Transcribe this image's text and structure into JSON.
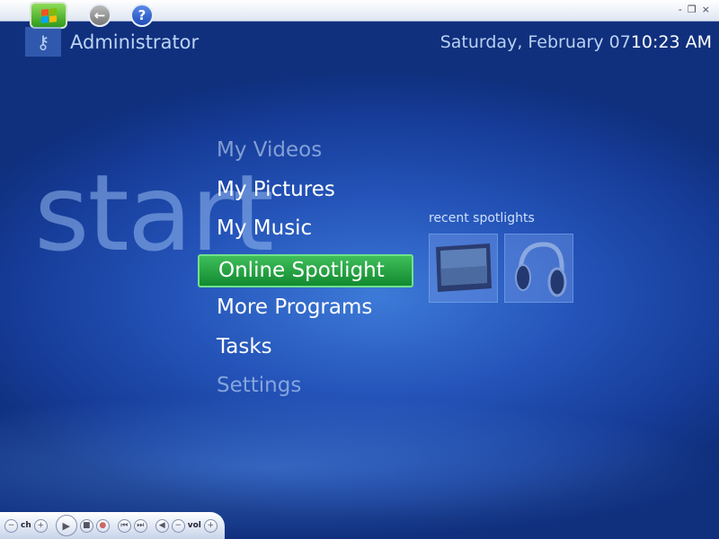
{
  "header": {
    "user": "Administrator",
    "date": "Saturday, February 07",
    "time": "10:23 AM"
  },
  "window_controls": {
    "minimize": "-",
    "restore": "❐",
    "close": "×"
  },
  "background_word": "start",
  "menu": {
    "items": [
      {
        "label": "My Videos",
        "state": "faded"
      },
      {
        "label": "My Pictures",
        "state": "normal"
      },
      {
        "label": "My Music",
        "state": "normal"
      },
      {
        "label": "Online Spotlight",
        "state": "selected"
      },
      {
        "label": "More Programs",
        "state": "normal"
      },
      {
        "label": "Tasks",
        "state": "normal"
      },
      {
        "label": "Settings",
        "state": "faded"
      }
    ]
  },
  "spotlights": {
    "label": "recent spotlights",
    "items": [
      "monitor-icon",
      "headphones-icon"
    ]
  },
  "transport": {
    "ch": "ch",
    "vol": "vol"
  },
  "colors": {
    "selected": "#1e9a3a",
    "background": "#1f4aa8"
  }
}
